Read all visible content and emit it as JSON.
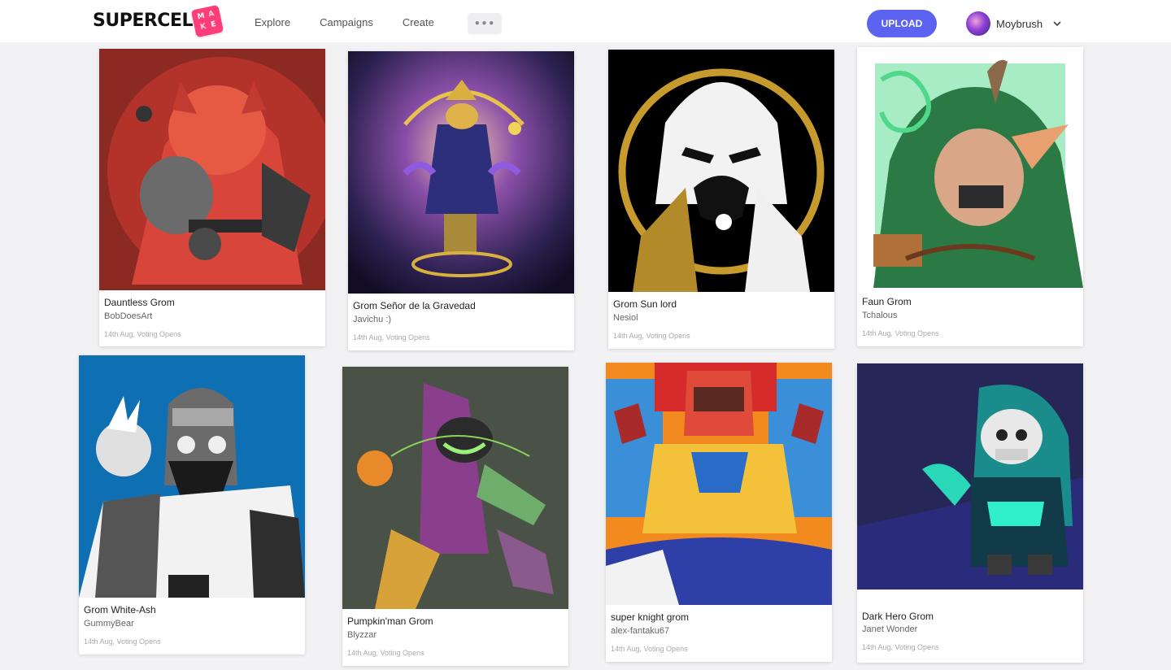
{
  "header": {
    "logo_text": "SUPERCELL",
    "logo_badge": [
      "M",
      "A",
      "K",
      "E"
    ],
    "nav": [
      "Explore",
      "Campaigns",
      "Create"
    ],
    "more_label": "•••",
    "upload_label": "UPLOAD",
    "username": "Moybrush"
  },
  "cards": [
    {
      "title": "Dauntless Grom",
      "author": "BobDoesArt",
      "status": "14th Aug, Voting Opens"
    },
    {
      "title": "Grom Señor de la Gravedad",
      "author": "Javichu :)",
      "status": "14th Aug, Voting Opens"
    },
    {
      "title": "Grom Sun lord",
      "author": "Nesiol",
      "status": "14th Aug, Voting Opens"
    },
    {
      "title": "Faun Grom",
      "author": "Tchalous",
      "status": "14th Aug, Voting Opens"
    },
    {
      "title": "Grom White-Ash",
      "author": "GummyBear",
      "status": "14th Aug, Voting Opens"
    },
    {
      "title": "Pumpkin'man Grom",
      "author": "Blyzzar",
      "status": "14th Aug, Voting Opens"
    },
    {
      "title": "super knight grom",
      "author": "alex-fantaku67",
      "status": "14th Aug, Voting Opens"
    },
    {
      "title": "Dark Hero Grom",
      "author": "Janet Wonder",
      "status": "14th Aug, Voting Opens"
    }
  ],
  "colors": {
    "accent": "#5b63f0",
    "badge": "#ff3d7a"
  }
}
